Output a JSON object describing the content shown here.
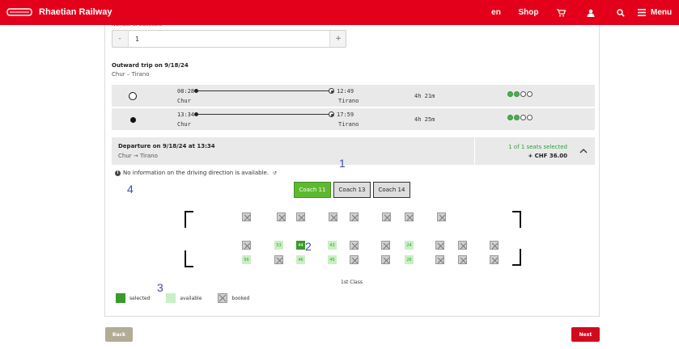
{
  "header": {
    "brand": "Rhaetian Railway",
    "lang": "en",
    "shop": "Shop",
    "menu": "Menu"
  },
  "travellers": {
    "label": "Number of travellers",
    "minus": "-",
    "value": "1",
    "plus": "+"
  },
  "trip": {
    "title": "Outward trip on 9/18/24",
    "route": "Chur – Tirano"
  },
  "connections": [
    {
      "dep_time": "08:28",
      "dep_station": "Chur",
      "arr_time": "12:49",
      "arr_station": "Tirano",
      "duration": "4h 21m",
      "selected": false,
      "occupancy": 2
    },
    {
      "dep_time": "13:34",
      "dep_station": "Chur",
      "arr_time": "17:59",
      "arr_station": "Tirano",
      "duration": "4h 25m",
      "selected": true,
      "occupancy": 2
    }
  ],
  "departure": {
    "title": "Departure on 9/18/24 at 13:34",
    "route": "Chur → Tirano",
    "seats_selected": "1 of 1 seats selected",
    "price": "+ CHF 36.00"
  },
  "info": "No information on the driving direction is available.",
  "annotations": {
    "a1": "1",
    "a2": "2",
    "a3": "3",
    "a4": "4"
  },
  "coaches": [
    "Coach 11",
    "Coach 13",
    "Coach 14"
  ],
  "active_coach": "Coach 11",
  "seats": {
    "top_row": [
      {
        "n": "",
        "s": "booked"
      },
      {
        "n": "",
        "s": "booked"
      },
      {
        "n": "",
        "s": "booked"
      },
      {
        "n": "",
        "s": "booked"
      },
      {
        "n": "",
        "s": "booked"
      },
      {
        "n": "",
        "s": "booked"
      },
      {
        "n": "",
        "s": "booked"
      },
      {
        "n": "",
        "s": "booked"
      }
    ],
    "mid_row": [
      {
        "n": "",
        "s": "booked"
      },
      {
        "n": "53",
        "s": "avail"
      },
      {
        "n": "44",
        "s": "selected"
      },
      {
        "n": "43",
        "s": "avail"
      },
      {
        "n": "",
        "s": "booked"
      },
      {
        "n": "",
        "s": "booked"
      },
      {
        "n": "24",
        "s": "avail"
      },
      {
        "n": "",
        "s": "booked"
      },
      {
        "n": "",
        "s": "booked"
      },
      {
        "n": "",
        "s": "booked"
      }
    ],
    "bot_row": [
      {
        "n": "56",
        "s": "avail"
      },
      {
        "n": "",
        "s": "booked"
      },
      {
        "n": "46",
        "s": "avail"
      },
      {
        "n": "45",
        "s": "avail"
      },
      {
        "n": "",
        "s": "booked"
      },
      {
        "n": "",
        "s": "booked"
      },
      {
        "n": "26",
        "s": "avail"
      },
      {
        "n": "",
        "s": "booked"
      },
      {
        "n": "",
        "s": "booked"
      },
      {
        "n": "",
        "s": "booked"
      }
    ]
  },
  "class_label": "1st Class",
  "legend": {
    "selected": "selected",
    "available": "available",
    "booked": "booked"
  },
  "colors": {
    "brand": "#e3001b",
    "selected": "#3a9a2c",
    "available": "#c9efc4",
    "booked": "#cfcfcf"
  },
  "buttons": {
    "back": "Back",
    "next": "Next"
  }
}
